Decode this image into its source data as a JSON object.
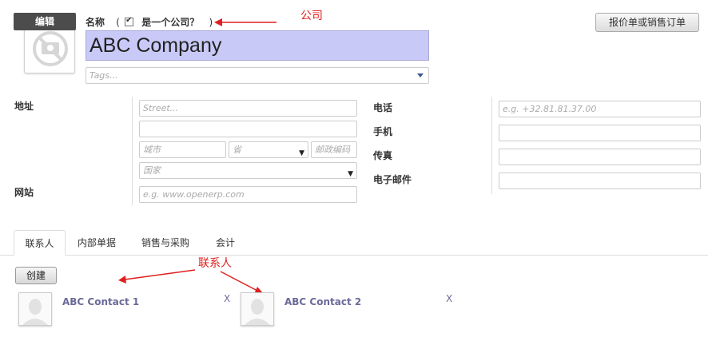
{
  "header": {
    "edit_label": "编辑",
    "name_label": "名称",
    "open_paren": "(",
    "is_company_label": "是一个公司？",
    "close_paren": ")",
    "name_value": "ABC Company",
    "tags_placeholder": "Tags...",
    "quote_button": "报价单或销售订单"
  },
  "annotations": {
    "company": "公司",
    "contacts": "联系人"
  },
  "address": {
    "label": "地址",
    "street_placeholder": "Street...",
    "street2_value": "",
    "city_placeholder": "城市",
    "state_placeholder": "省",
    "zip_placeholder": "邮政编码",
    "country_placeholder": "国家"
  },
  "website": {
    "label": "网站",
    "placeholder": "e.g. www.openerp.com"
  },
  "contact_fields": {
    "phone_label": "电话",
    "phone_placeholder": "e.g. +32.81.81.37.00",
    "mobile_label": "手机",
    "fax_label": "传真",
    "email_label": "电子邮件"
  },
  "tabs": [
    {
      "label": "联系人"
    },
    {
      "label": "内部单据"
    },
    {
      "label": "销售与采购"
    },
    {
      "label": "会计"
    }
  ],
  "contacts_tab": {
    "create_label": "创建",
    "contacts": [
      {
        "name": "ABC Contact 1",
        "remove": "X"
      },
      {
        "name": "ABC Contact 2",
        "remove": "X"
      }
    ]
  },
  "colors": {
    "annotation_red": "#e02020",
    "name_field_bg": "#c9c9f7",
    "contact_link": "#6a6a9a"
  }
}
